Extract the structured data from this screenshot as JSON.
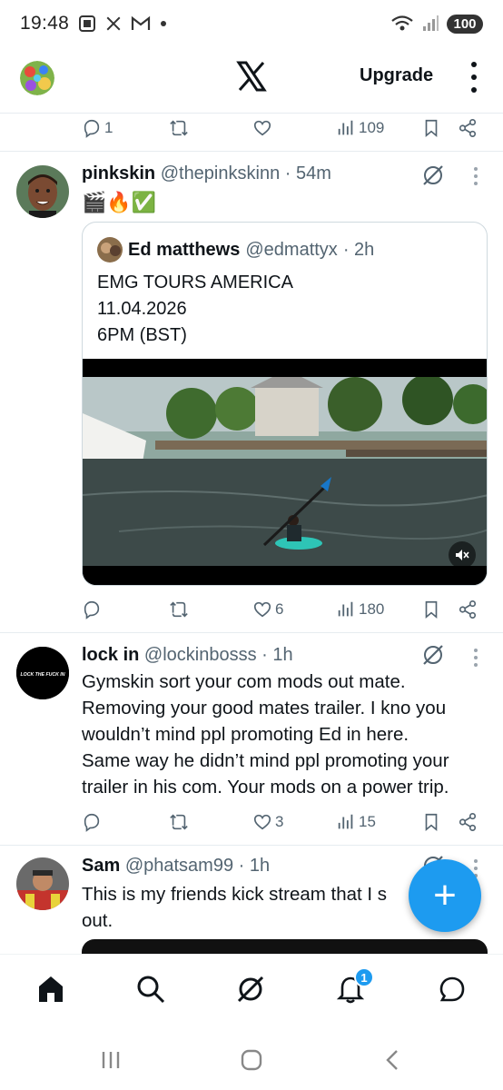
{
  "status_bar": {
    "time": "19:48",
    "battery": "100",
    "notification_icons": [
      "screenshot-icon",
      "x-app-icon",
      "gmail-icon",
      "dot-icon"
    ]
  },
  "header": {
    "upgrade_label": "Upgrade"
  },
  "prev_tweet_actions": {
    "reply_count": "1",
    "retweet_count": "",
    "like_count": "",
    "views_count": "109"
  },
  "tweets": [
    {
      "name": "pinkskin",
      "handle": "@thepinkskinn",
      "time": "· 54m",
      "text": "🎬🔥✅",
      "quote": {
        "name": "Ed matthews",
        "handle": "@edmattyx",
        "time": "· 2h",
        "lines": [
          "EMG TOURS AMERICA",
          "11.04.2026",
          "6PM (BST)"
        ]
      },
      "reply_count": "",
      "retweet_count": "",
      "like_count": "6",
      "views_count": "180"
    },
    {
      "name": "lock in",
      "handle": "@lockinbosss",
      "time": "· 1h",
      "avatar_text": "LOCK THE FUCK IN",
      "lines": [
        "Gymskin sort your com mods out mate.",
        "Removing your good mates trailer. I kno you",
        "wouldn’t mind ppl promoting Ed in here.",
        "Same way he didn’t mind ppl promoting your",
        "trailer in his com. Your mods on a power trip."
      ],
      "reply_count": "",
      "retweet_count": "",
      "like_count": "3",
      "views_count": "15"
    },
    {
      "name": "Sam",
      "handle": "@phatsam99",
      "time": "· 1h",
      "lines": [
        "This is my friends kick stream that I s",
        "out."
      ]
    }
  ],
  "bottom_nav": {
    "notifications_badge": "1"
  },
  "colors": {
    "accent": "#1d9bf0",
    "text": "#0f1419",
    "muted": "#536471"
  }
}
